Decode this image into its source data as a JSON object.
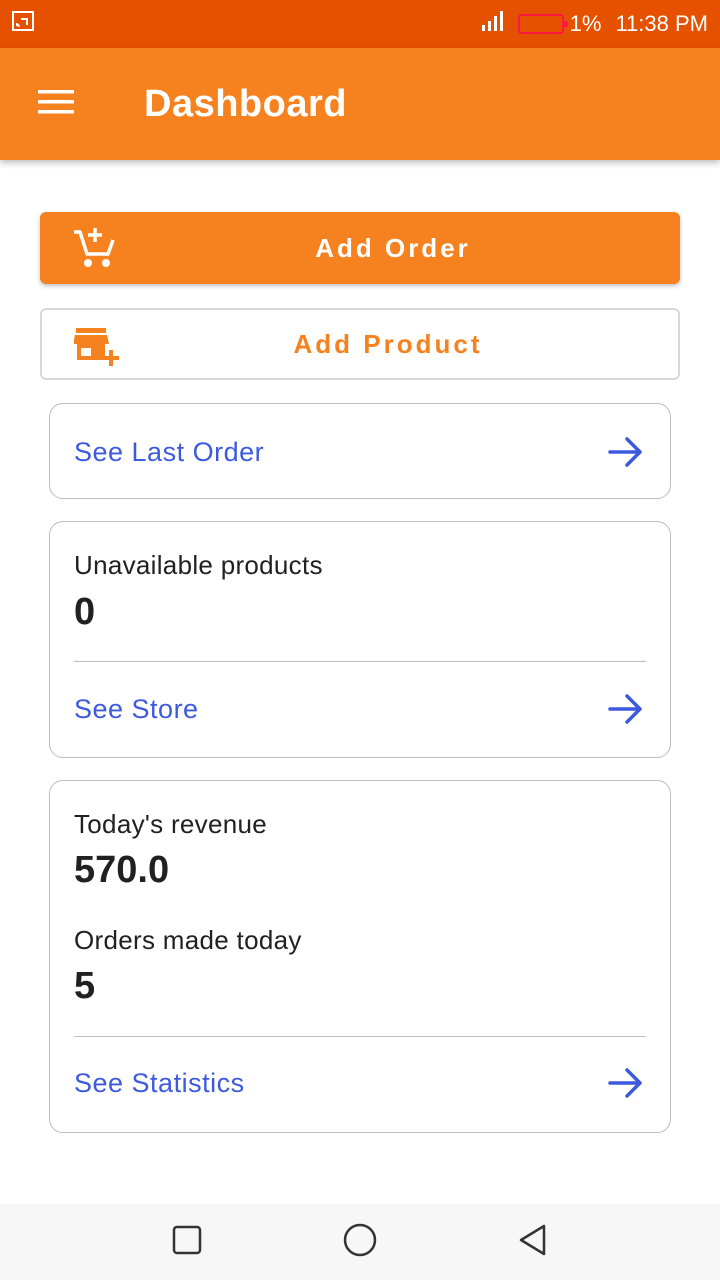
{
  "status_bar": {
    "battery_percent": "1%",
    "time": "11:38 PM",
    "screencast_icon": "screencast-icon",
    "signal_icon": "signal-icon",
    "battery_color": "#ff1744"
  },
  "app_bar": {
    "title": "Dashboard",
    "menu_icon": "menu-icon",
    "color": "#f5821f"
  },
  "actions": {
    "add_order_label": "Add Order",
    "add_order_icon": "add-cart-icon",
    "add_product_label": "Add Product",
    "add_product_icon": "add-store-icon"
  },
  "last_order": {
    "link_label": "See Last Order"
  },
  "store": {
    "unavailable_label": "Unavailable products",
    "unavailable_value": "0",
    "link_label": "See Store"
  },
  "stats": {
    "revenue_label": "Today's revenue",
    "revenue_value": "570.0",
    "orders_label": "Orders made today",
    "orders_value": "5",
    "link_label": "See Statistics"
  },
  "nav_bar": {
    "recents_icon": "square-icon",
    "home_icon": "circle-icon",
    "back_icon": "back-triangle-icon"
  },
  "colors": {
    "accent": "#f5821f",
    "status_bar": "#e65100",
    "link": "#3d5adf"
  }
}
